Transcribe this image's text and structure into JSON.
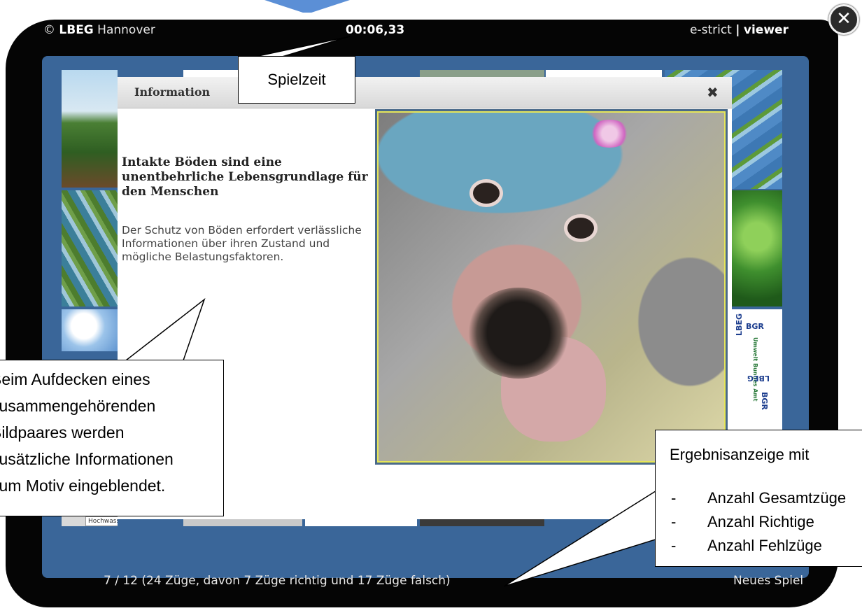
{
  "viewer": {
    "copyright": "© LBEG Hannover",
    "copyright_brand": "LBEG",
    "copyright_rest": " Hannover",
    "timer": "00:06,33",
    "brand_left": "e-strict",
    "brand_sep": "|",
    "brand_right": "viewer",
    "close_label": "✕"
  },
  "dialog": {
    "title": "Information",
    "close_label": "✖",
    "heading": "Intakte Böden sind eine unentbehrliche Lebensgrundlage für den Menschen",
    "body": "Der Schutz von Böden erfordert verlässliche Informationen über ihren Zustand und mögliche Belastungsfaktoren."
  },
  "board": {
    "tile_hochwasser_label": "Hochwass",
    "logo_texts": [
      "BGR",
      "LBEG",
      "Umwelt Bundes Amt",
      "LBEG",
      "BGR"
    ]
  },
  "status": {
    "progress": "7 / 12 (24 Züge, davon 7 Züge richtig und 17 Züge falsch)",
    "new_game": "Neues Spiel"
  },
  "callouts": {
    "timer_label": "Spielzeit",
    "info_lines": [
      "Beim Aufdecken eines",
      "zusammengehörenden",
      "Bildpaares werden",
      "zusätzliche Informationen",
      "zum Motiv eingeblendet."
    ],
    "result_title": "Ergebnisanzeige mit",
    "result_items": [
      "Anzahl Gesamtzüge",
      "Anzahl Richtige",
      "Anzahl Fehlzüge"
    ],
    "bullet": "-"
  },
  "colors": {
    "frame": "#050505",
    "board": "#3a6699",
    "dialog_bar": "#d8d8d8",
    "photo_border": "#e6e65a"
  }
}
